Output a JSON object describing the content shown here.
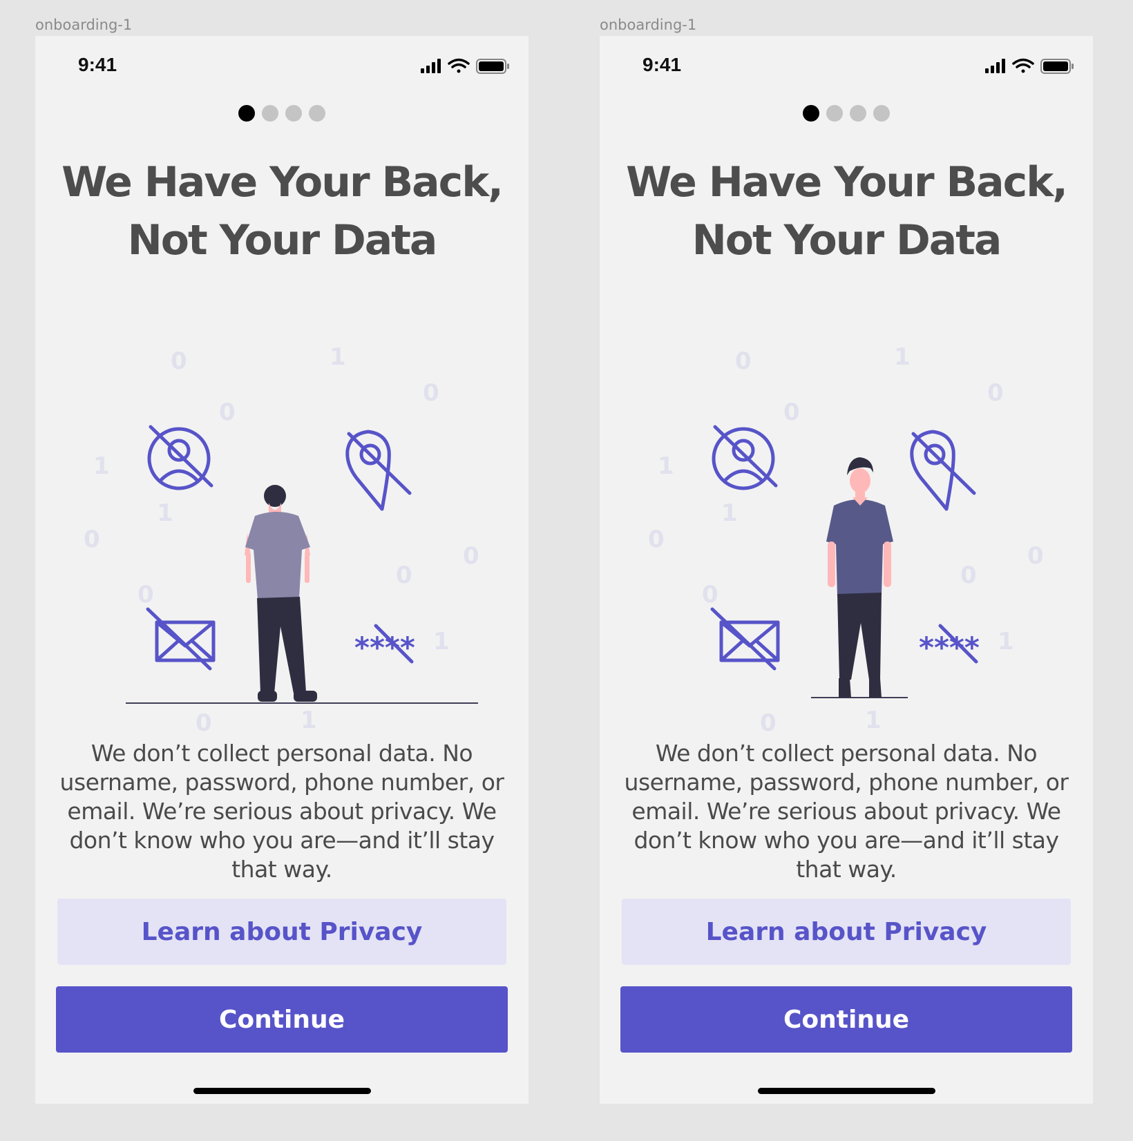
{
  "frames": [
    {
      "label": "onboarding-1",
      "status": {
        "time": "9:41"
      },
      "pager": {
        "total": 4,
        "active": 1
      },
      "headline": "We Have Your Back, Not Your Data",
      "illustration": {
        "icons": [
          "no-user-icon",
          "no-location-icon",
          "no-mail-icon",
          "no-password-icon"
        ],
        "binary_digits": [
          "0",
          "1",
          "0",
          "0",
          "1",
          "1",
          "0",
          "0",
          "0",
          "0",
          "1",
          "0",
          "1"
        ],
        "person": "person-back-view"
      },
      "body": "We don’t collect personal data. No username, password, phone number, or email. We’re serious about privacy. We don’t know who you are—and it’ll stay that way.",
      "buttons": {
        "secondary": "Learn about Privacy",
        "primary": "Continue"
      }
    },
    {
      "label": "onboarding-1",
      "status": {
        "time": "9:41"
      },
      "pager": {
        "total": 4,
        "active": 1
      },
      "headline": "We Have Your Back, Not Your Data",
      "illustration": {
        "icons": [
          "no-user-icon",
          "no-location-icon",
          "no-mail-icon",
          "no-password-icon"
        ],
        "binary_digits": [
          "0",
          "1",
          "0",
          "0",
          "1",
          "1",
          "0",
          "0",
          "0",
          "0",
          "1",
          "0",
          "1"
        ],
        "person": "person-front-view"
      },
      "body": "We don’t collect personal data. No username, password, phone number, or email. We’re serious about privacy. We don’t know who you are—and it’ll stay that way.",
      "buttons": {
        "secondary": "Learn about Privacy",
        "primary": "Continue"
      }
    }
  ],
  "colors": {
    "accent": "#5754c9",
    "accent_light": "#e4e3f5",
    "text_dark": "#4d4d4d",
    "background": "#f2f2f2",
    "canvas": "#e5e5e5"
  }
}
